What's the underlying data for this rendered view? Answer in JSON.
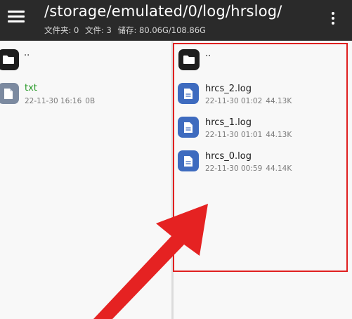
{
  "appbar": {
    "path": "/storage/emulated/0/log/hrslog/",
    "folders_text": "文件夹: 0",
    "files_text": "文件: 3",
    "storage_text": "储存: 80.06G/108.86G"
  },
  "left_pane": {
    "parent_label": "..",
    "items": [
      {
        "name": "txt",
        "date": "22-11-30 16:16",
        "size": "0B",
        "icon": "text-file-icon"
      }
    ]
  },
  "right_pane": {
    "parent_label": "..",
    "items": [
      {
        "name": "hrcs_2.log",
        "date": "22-11-30 01:02",
        "size": "44.13K",
        "icon": "document-icon"
      },
      {
        "name": "hrcs_1.log",
        "date": "22-11-30 01:01",
        "size": "44.13K",
        "icon": "document-icon"
      },
      {
        "name": "hrcs_0.log",
        "date": "22-11-30 00:59",
        "size": "44.14K",
        "icon": "document-icon"
      }
    ]
  },
  "colors": {
    "appbar": "#2a2a2a",
    "folder_icon_bg": "#1e1e1e",
    "doc_icon_bg": "#3e6bbf",
    "txt_icon_bg": "#7c8aa0",
    "annotation": "#e02020",
    "txt_name": "#2a9b2a"
  }
}
